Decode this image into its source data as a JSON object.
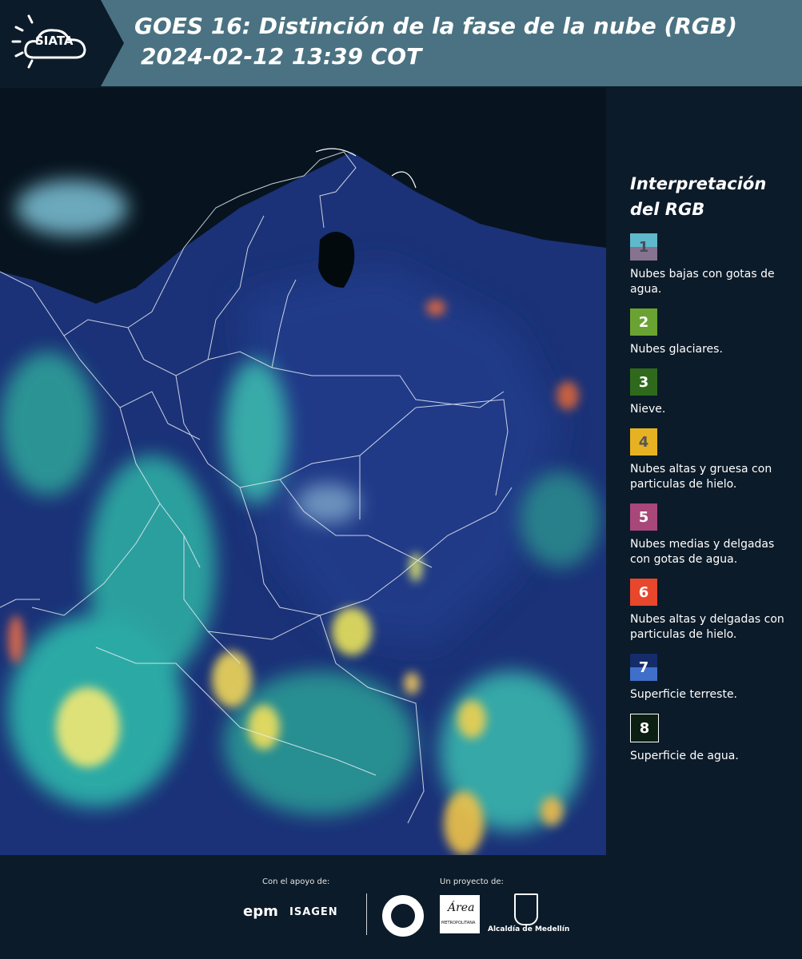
{
  "header": {
    "logo_text": "SIATA",
    "title_line1": "GOES 16: Distinción de la fase de la nube (RGB)",
    "title_line2": "2024-02-12 13:39 COT"
  },
  "legend": {
    "title_line1": "Interpretación",
    "title_line2": "del RGB",
    "items": [
      {
        "num": "1",
        "text": "Nubes bajas con gotas de agua.",
        "color_top": "#5eb9cc",
        "color_bottom": "#85738f",
        "num_color": "#4a4a5a"
      },
      {
        "num": "2",
        "text": "Nubes glaciares.",
        "color_top": "#6aa332",
        "color_bottom": "#6aa332",
        "num_color": "#ffffff"
      },
      {
        "num": "3",
        "text": "Nieve.",
        "color_top": "#2f6a1c",
        "color_bottom": "#2f6a1c",
        "num_color": "#ffffff"
      },
      {
        "num": "4",
        "text": "Nubes altas y gruesa con particulas de hielo.",
        "color_top": "#e7b222",
        "color_bottom": "#e7b222",
        "num_color": "#555555"
      },
      {
        "num": "5",
        "text": "Nubes medias y delgadas con gotas de agua.",
        "color_top": "#a8477a",
        "color_bottom": "#a8477a",
        "num_color": "#ffffff"
      },
      {
        "num": "6",
        "text": "Nubes altas y delgadas con particulas de hielo.",
        "color_top": "#e8472c",
        "color_bottom": "#e8472c",
        "num_color": "#ffffff"
      },
      {
        "num": "7",
        "text": "Superficie terreste.",
        "color_top": "#142c6a",
        "color_bottom": "#3f6fc9",
        "num_color": "#ffffff"
      },
      {
        "num": "8",
        "text": "Superficie de agua.",
        "color_top": "#0b1f12",
        "color_bottom": "#0b1f12",
        "num_color": "#ffffff"
      }
    ]
  },
  "footer": {
    "support_caption": "Con el apoyo de:",
    "project_caption": "Un proyecto de:",
    "sponsor1": "epm",
    "sponsor2": "ISAGEN",
    "partner_area": "Área",
    "partner_area_sub": "METROPOLITANA",
    "partner_alcaldia": "Alcaldía de Medellín"
  }
}
